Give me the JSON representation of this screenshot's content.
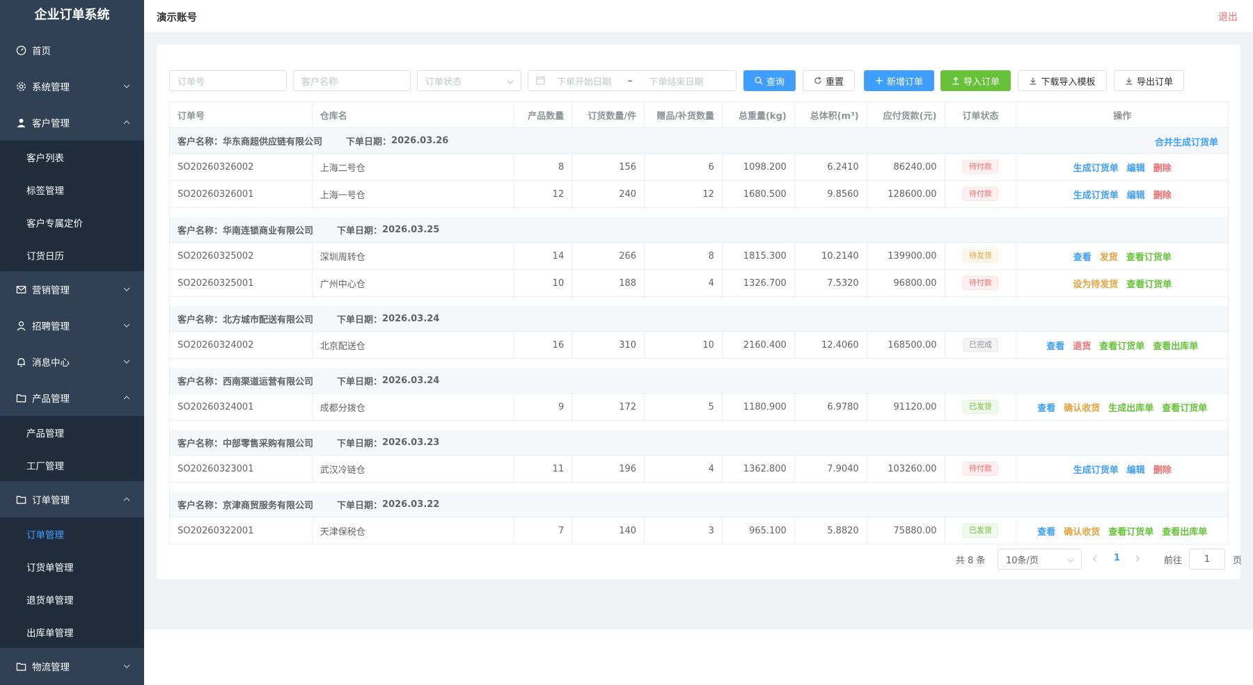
{
  "app": {
    "title": "企业订单系统"
  },
  "header": {
    "account": "演示账号",
    "logout": "退出"
  },
  "sidebar": {
    "home": "首页",
    "system": "系统管理",
    "customer": {
      "label": "客户管理",
      "items": [
        "客户列表",
        "标签管理",
        "客户专属定价",
        "订货日历"
      ]
    },
    "marketing": "营销管理",
    "recruit": "招聘管理",
    "message": "消息中心",
    "product": {
      "label": "产品管理",
      "items": [
        "产品管理",
        "工厂管理"
      ]
    },
    "order": {
      "label": "订单管理",
      "items": [
        "订单管理",
        "订货单管理",
        "退货单管理",
        "出库单管理"
      ],
      "active": "订单管理"
    },
    "logistics": "物流管理"
  },
  "filters": {
    "order_no_placeholder": "订单号",
    "customer_placeholder": "客户名称",
    "status_placeholder": "订单状态",
    "start_date_placeholder": "下单开始日期",
    "date_separator": "–",
    "end_date_placeholder": "下单结束日期"
  },
  "toolbar": {
    "search": "查询",
    "reset": "重置",
    "add": "新增订单",
    "import": "导入订单",
    "download_template": "下载导入模板",
    "export": "导出订单"
  },
  "table": {
    "columns": [
      "订单号",
      "仓库名",
      "产品数量",
      "订货数量/件",
      "赠品/补货数量",
      "总重量(kg)",
      "总体积(m³)",
      "应付货款(元)",
      "订单状态",
      "操作"
    ],
    "customer_label": "客户名称：",
    "date_label": "下单日期：",
    "merge_action": "合并生成订货单",
    "groups": [
      {
        "customer": "华东商超供应链有限公司",
        "date": "2026.03.26",
        "rows": [
          {
            "order_no": "SO20260326002",
            "warehouse": "上海二号仓",
            "product_qty": "8",
            "order_qty": "156",
            "gift_qty": "6",
            "weight": "1098.200",
            "volume": "6.2410",
            "amount": "86240.00",
            "status": "待付款",
            "status_color": "#f56c6c",
            "actions": [
              {
                "label": "生成订货单",
                "color": "#409eff"
              },
              {
                "label": "编辑",
                "color": "#409eff"
              },
              {
                "label": "删除",
                "color": "#f56c6c"
              }
            ]
          },
          {
            "order_no": "SO20260326001",
            "warehouse": "上海一号仓",
            "product_qty": "12",
            "order_qty": "240",
            "gift_qty": "12",
            "weight": "1680.500",
            "volume": "9.8560",
            "amount": "128600.00",
            "status": "待付款",
            "status_color": "#f56c6c",
            "actions": [
              {
                "label": "生成订货单",
                "color": "#409eff"
              },
              {
                "label": "编辑",
                "color": "#409eff"
              },
              {
                "label": "删除",
                "color": "#f56c6c"
              }
            ]
          }
        ]
      },
      {
        "customer": "华南连锁商业有限公司",
        "date": "2026.03.25",
        "rows": [
          {
            "order_no": "SO20260325002",
            "warehouse": "深圳周转仓",
            "product_qty": "14",
            "order_qty": "266",
            "gift_qty": "8",
            "weight": "1815.300",
            "volume": "10.2140",
            "amount": "139900.00",
            "status": "待发货",
            "status_color": "#e6a23c",
            "actions": [
              {
                "label": "查看",
                "color": "#409eff"
              },
              {
                "label": "发货",
                "color": "#e6a23c"
              },
              {
                "label": "查看订货单",
                "color": "#67c23a"
              }
            ]
          },
          {
            "order_no": "SO20260325001",
            "warehouse": "广州中心仓",
            "product_qty": "10",
            "order_qty": "188",
            "gift_qty": "4",
            "weight": "1326.700",
            "volume": "7.5320",
            "amount": "96800.00",
            "status": "待付款",
            "status_color": "#f56c6c",
            "actions": [
              {
                "label": "设为待发货",
                "color": "#e6a23c"
              },
              {
                "label": "查看订货单",
                "color": "#67c23a"
              }
            ]
          }
        ]
      },
      {
        "customer": "北方城市配送有限公司",
        "date": "2026.03.24",
        "rows": [
          {
            "order_no": "SO20260324002",
            "warehouse": "北京配送仓",
            "product_qty": "16",
            "order_qty": "310",
            "gift_qty": "10",
            "weight": "2160.400",
            "volume": "12.4060",
            "amount": "168500.00",
            "status": "已完成",
            "status_color": "#909399",
            "actions": [
              {
                "label": "查看",
                "color": "#409eff"
              },
              {
                "label": "退货",
                "color": "#f56c6c"
              },
              {
                "label": "查看订货单",
                "color": "#67c23a"
              },
              {
                "label": "查看出库单",
                "color": "#67c23a"
              }
            ]
          }
        ]
      },
      {
        "customer": "西南渠道运营有限公司",
        "date": "2026.03.24",
        "rows": [
          {
            "order_no": "SO20260324001",
            "warehouse": "成都分拨仓",
            "product_qty": "9",
            "order_qty": "172",
            "gift_qty": "5",
            "weight": "1180.900",
            "volume": "6.9780",
            "amount": "91120.00",
            "status": "已发货",
            "status_color": "#67c23a",
            "actions": [
              {
                "label": "查看",
                "color": "#409eff"
              },
              {
                "label": "确认收货",
                "color": "#e6a23c"
              },
              {
                "label": "生成出库单",
                "color": "#67c23a"
              },
              {
                "label": "查看订货单",
                "color": "#67c23a"
              }
            ]
          }
        ]
      },
      {
        "customer": "中部零售采购有限公司",
        "date": "2026.03.23",
        "rows": [
          {
            "order_no": "SO20260323001",
            "warehouse": "武汉冷链仓",
            "product_qty": "11",
            "order_qty": "196",
            "gift_qty": "4",
            "weight": "1362.800",
            "volume": "7.9040",
            "amount": "103260.00",
            "status": "待付款",
            "status_color": "#f56c6c",
            "actions": [
              {
                "label": "生成订货单",
                "color": "#409eff"
              },
              {
                "label": "编辑",
                "color": "#409eff"
              },
              {
                "label": "删除",
                "color": "#f56c6c"
              }
            ]
          }
        ]
      },
      {
        "customer": "京津商贸服务有限公司",
        "date": "2026.03.22",
        "rows": [
          {
            "order_no": "SO20260322001",
            "warehouse": "天津保税仓",
            "product_qty": "7",
            "order_qty": "140",
            "gift_qty": "3",
            "weight": "965.100",
            "volume": "5.8820",
            "amount": "75880.00",
            "status": "已发货",
            "status_color": "#67c23a",
            "actions": [
              {
                "label": "查看",
                "color": "#409eff"
              },
              {
                "label": "确认收货",
                "color": "#e6a23c"
              },
              {
                "label": "查看订货单",
                "color": "#67c23a"
              },
              {
                "label": "查看出库单",
                "color": "#67c23a"
              }
            ]
          }
        ]
      }
    ]
  },
  "pagination": {
    "total": "共 8 条",
    "page_size": "10条/页",
    "current": "1",
    "goto_label": "前往",
    "goto_value": "1",
    "page_unit": "页"
  },
  "colors": {
    "sidebar_bg": "#304156",
    "submenu_bg": "#1f2d3d",
    "primary": "#409eff",
    "success": "#67c23a",
    "danger": "#f56c6c",
    "warning": "#e6a23c"
  }
}
